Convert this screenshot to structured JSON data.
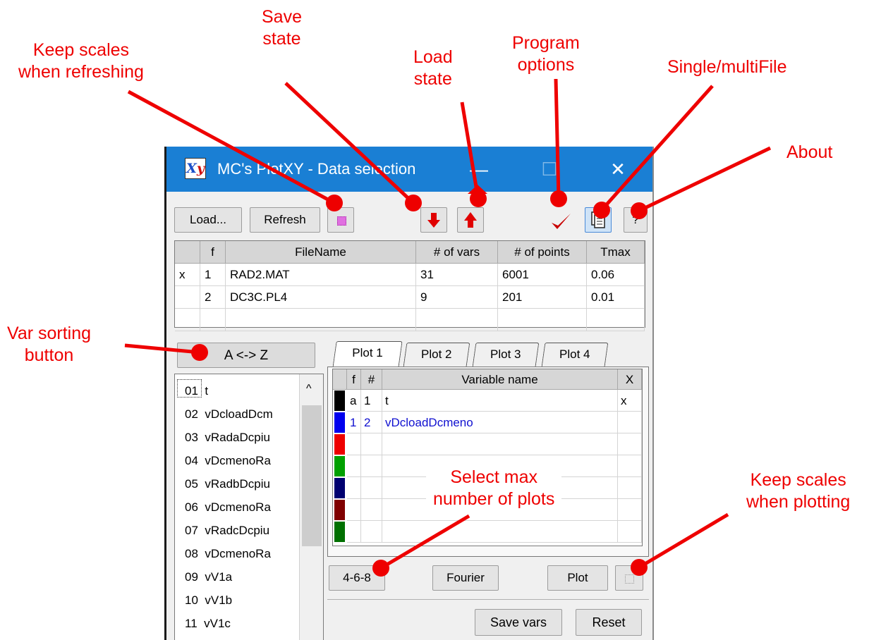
{
  "callouts": {
    "keep_scales_refresh": "Keep scales\nwhen refreshing",
    "save_state": "Save\nstate",
    "load_state": "Load\nstate",
    "program_options": "Program\noptions",
    "single_multifile": "Single/multiFile",
    "about": "About",
    "var_sorting": "Var sorting\nbutton",
    "select_max_plots": "Select max\nnumber of plots",
    "keep_scales_plotting": "Keep scales\nwhen plotting"
  },
  "window": {
    "title": "MC's PlotXY - Data selection",
    "minimize": "—",
    "maximize": "☐",
    "close": "✕"
  },
  "toolbar": {
    "load": "Load...",
    "refresh": "Refresh",
    "help": "?"
  },
  "file_table": {
    "headers": [
      "",
      "f",
      "FileName",
      "# of vars",
      "# of points",
      "Tmax"
    ],
    "rows": [
      {
        "mark": "x",
        "f": "1",
        "name": "RAD2.MAT",
        "vars": "31",
        "points": "6001",
        "tmax": "0.06"
      },
      {
        "mark": "",
        "f": "2",
        "name": "DC3C.PL4",
        "vars": "9",
        "points": "201",
        "tmax": "0.01"
      }
    ]
  },
  "sort_button": "A <-> Z",
  "var_list": [
    {
      "num": "01",
      "name": "t"
    },
    {
      "num": "02",
      "name": "vDcloadDcm"
    },
    {
      "num": "03",
      "name": "vRadaDcpiu"
    },
    {
      "num": "04",
      "name": "vDcmenoRa"
    },
    {
      "num": "05",
      "name": "vRadbDcpiu"
    },
    {
      "num": "06",
      "name": "vDcmenoRa"
    },
    {
      "num": "07",
      "name": "vRadcDcpiu"
    },
    {
      "num": "08",
      "name": "vDcmenoRa"
    },
    {
      "num": "09",
      "name": "vV1a"
    },
    {
      "num": "10",
      "name": "vV1b"
    },
    {
      "num": "11",
      "name": "vV1c"
    }
  ],
  "tabs": [
    "Plot 1",
    "Plot 2",
    "Plot 3",
    "Plot 4"
  ],
  "plot_table": {
    "headers": [
      "",
      "f",
      "#",
      "Variable name",
      "X"
    ],
    "rows": [
      {
        "color": "#000000",
        "f": "a",
        "num": "1",
        "name": "t",
        "x": "x",
        "text_color": "#000000"
      },
      {
        "color": "#0000ee",
        "f": "1",
        "num": "2",
        "name": "vDcloadDcmeno",
        "x": "",
        "text_color": "#1010d0"
      },
      {
        "color": "#ee0000",
        "f": "",
        "num": "",
        "name": "",
        "x": "",
        "text_color": "#000000"
      },
      {
        "color": "#00a000",
        "f": "",
        "num": "",
        "name": "",
        "x": "",
        "text_color": "#000000"
      },
      {
        "color": "#000070",
        "f": "",
        "num": "",
        "name": "",
        "x": "",
        "text_color": "#000000"
      },
      {
        "color": "#800000",
        "f": "",
        "num": "",
        "name": "",
        "x": "",
        "text_color": "#000000"
      },
      {
        "color": "#007000",
        "f": "",
        "num": "",
        "name": "",
        "x": "",
        "text_color": "#000000"
      }
    ]
  },
  "buttons": {
    "max_plots": "4-6-8",
    "fourier": "Fourier",
    "plot": "Plot",
    "save_vars": "Save vars",
    "reset": "Reset"
  }
}
